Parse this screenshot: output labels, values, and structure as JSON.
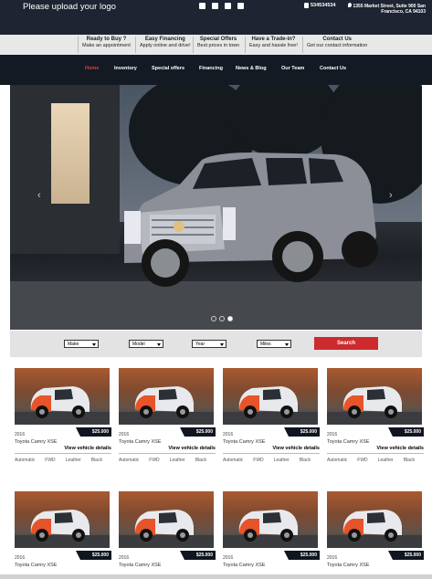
{
  "header": {
    "logo_text": "Please upload your logo",
    "social_icons": [
      "facebook-icon",
      "twitter-icon",
      "instagram-icon",
      "youtube-icon"
    ],
    "phone": "534534534",
    "address": "1355 Market Street, Suite 900 San Francisco, CA 94103"
  },
  "info_bar": [
    {
      "title": "Ready to Buy ?",
      "sub": "Make an appointment"
    },
    {
      "title": "Easy Financing",
      "sub": "Apply online and drive!"
    },
    {
      "title": "Special Offers",
      "sub": "Best prices in town"
    },
    {
      "title": "Have a Trade-in?",
      "sub": "Easy and hassle free!"
    },
    {
      "title": "Contact Us",
      "sub": "Get our contact information"
    }
  ],
  "nav": {
    "items": [
      "Home",
      "Inventory",
      "Special offers",
      "Financing",
      "News & Blog",
      "Our Team",
      "Contact Us"
    ],
    "active": "Home"
  },
  "slider": {
    "dots": 3,
    "active_dot": 3
  },
  "search": {
    "make": "Make",
    "model": "Model",
    "year": "Year",
    "miles": "Miles",
    "button": "Search"
  },
  "listing": {
    "year": "2016",
    "price": "$25.000",
    "model": "Toyota Camry XSE",
    "view_label": "View vehicle details",
    "specs": [
      "Automatic",
      "FWD",
      "Leather",
      "Black"
    ]
  },
  "colors": {
    "top_bar": "#1e2431",
    "nav_bar": "#141a24",
    "accent": "#cc2a2e"
  }
}
